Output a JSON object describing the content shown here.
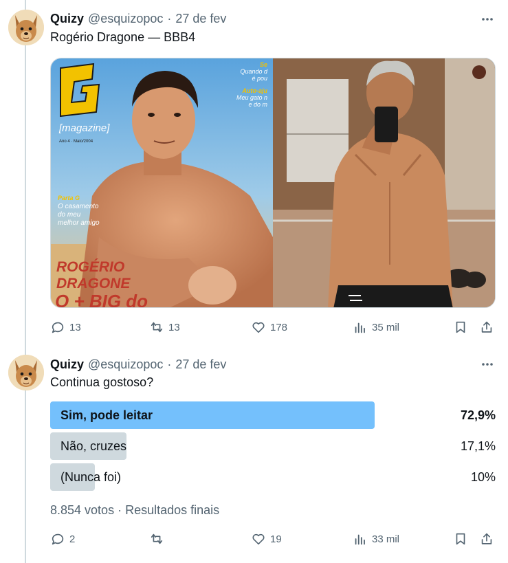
{
  "tweets": [
    {
      "author": {
        "name": "Quizy",
        "handle": "@esquizopoc",
        "date": "27 de fev"
      },
      "text": "Rogério Dragone — BBB4",
      "media": {
        "left": {
          "masthead": "G",
          "sub": "[magazine]",
          "issue": "Ano 4 · Maio/2004",
          "corner_lines": [
            "Se",
            "Quando d",
            "é pou",
            "Auto-aju",
            "Meu gato n",
            "e do m"
          ],
          "teaser_lines": [
            "Parta G",
            "O casamento",
            "do meu",
            "melhor amigo"
          ],
          "cover_name_1": "ROGÉRIO",
          "cover_name_2": "DRAGONE",
          "cover_tag": "O + BIG do"
        }
      },
      "stats": {
        "replies": "13",
        "retweets": "13",
        "likes": "178",
        "views": "35 mil"
      }
    },
    {
      "author": {
        "name": "Quizy",
        "handle": "@esquizopoc",
        "date": "27 de fev"
      },
      "text": "Continua gostoso?",
      "poll": {
        "options": [
          {
            "label": "Sim, pode leitar",
            "percent": "72,9%",
            "value": 72.9,
            "winner": true
          },
          {
            "label": "Não, cruzes",
            "percent": "17,1%",
            "value": 17.1,
            "winner": false
          },
          {
            "label": "(Nunca foi)",
            "percent": "10%",
            "value": 10,
            "winner": false
          }
        ],
        "votes": "8.854 votos",
        "status": "Resultados finais"
      },
      "stats": {
        "replies": "2",
        "retweets": "",
        "likes": "19",
        "views": "33 mil"
      }
    }
  ],
  "colors": {
    "text": "#0f1419",
    "muted": "#536471",
    "poll_winner": "#74c0fc",
    "poll_other": "#cfd9de",
    "thread_line": "#cfd9de"
  },
  "icons": [
    "dog-avatar",
    "more-icon",
    "reply-icon",
    "retweet-icon",
    "like-icon",
    "views-icon",
    "bookmark-icon",
    "share-icon"
  ]
}
